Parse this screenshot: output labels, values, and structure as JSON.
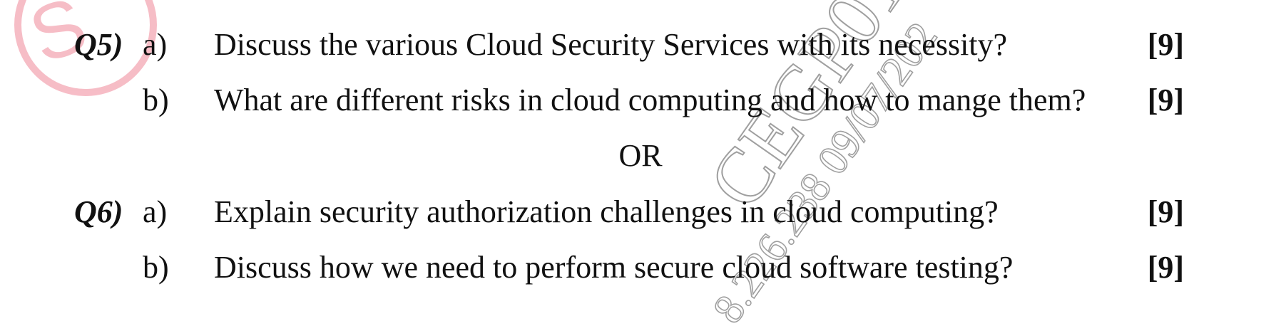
{
  "questions": [
    {
      "number": "Q5)",
      "parts": [
        {
          "label": "a)",
          "text": "Discuss the various Cloud Security Services with its necessity?",
          "marks": "[9]"
        },
        {
          "label": "b)",
          "text": "What are different risks in cloud computing and how to mange them?",
          "marks": "[9]"
        }
      ]
    },
    {
      "number": "Q6)",
      "parts": [
        {
          "label": "a)",
          "text": "Explain security authorization challenges in cloud computing?",
          "marks": "[9]"
        },
        {
          "label": "b)",
          "text": "Discuss how we need to perform secure cloud software testing?",
          "marks": "[9]"
        }
      ]
    }
  ],
  "separator": "OR",
  "watermark": {
    "text": "CEGP01 8.226.238 09/07/202",
    "corner_mark": "S",
    "color": "#9a9a9a",
    "corner_color": "#f4a7b4"
  }
}
